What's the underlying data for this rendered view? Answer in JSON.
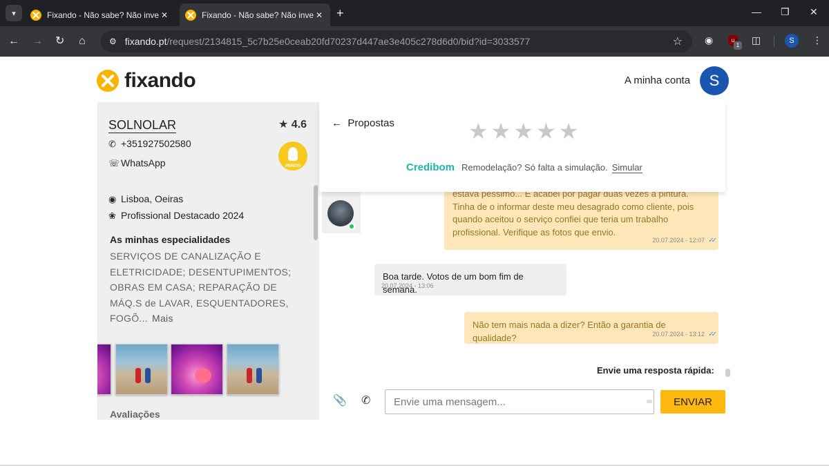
{
  "browser": {
    "tabs": [
      {
        "title": "Fixando - Não sabe? Não inventa!",
        "active": false
      },
      {
        "title": "Fixando - Não sabe? Não inventa!",
        "active": true
      }
    ],
    "url_host": "fixando.pt",
    "url_path": "/request/2134815_5c7b25e0ceab20fd70237d447ae3e405c278d6d0/bid?id=3033577",
    "profile_initial": "S",
    "extension_badge": "1"
  },
  "site": {
    "logo_text": "fixando",
    "account_label": "A minha conta",
    "avatar_initial": "S",
    "brand_color": "#f9b400"
  },
  "professional": {
    "name": "SOLNOLAR",
    "rating": "4.6",
    "phone": "+351927502580",
    "whatsapp": "WhatsApp",
    "badge_label": "PERITO",
    "location": "Lisboa, Oeiras",
    "highlight": "Profissional Destacado 2024",
    "specialties_title": "As minhas especialidades",
    "specialties_text": "SERVIÇOS DE CANALIZAÇÃO E ELETRICIDADE; DESENTUPIMENTOS; OBRAS EM CASA; REPARAÇÃO DE MÁQ.S de LAVAR, ESQUENTADORES, FOGÕ...",
    "specialties_more": "Mais",
    "reviews_title": "Avaliações"
  },
  "chat": {
    "back_label": "Propostas",
    "rating_stars": 5,
    "promo_brand": "Credibom",
    "promo_text": "Remodelação? Só falta a simulação.",
    "promo_link": "Simular",
    "messages": [
      {
        "direction": "out",
        "text": "estava péssimo... E acabei por pagar duas vezes a pintura. Tinha de o informar deste meu desagrado como cliente, pois quando aceitou o serviço confiei que teria um trabalho profissional. Verifique as fotos que envio.",
        "time": "20.07.2024 - 12:07"
      },
      {
        "direction": "in",
        "text": "Boa tarde. Votos de um bom fim de semana.",
        "time": "20.07.2024 - 13:06"
      },
      {
        "direction": "out",
        "text": "Não tem mais nada a dizer? Então a garantia de qualidade?",
        "time": "20.07.2024 - 13:12"
      }
    ],
    "quick_reply_label": "Envie uma resposta rápida:",
    "input_placeholder": "Envie uma mensagem...",
    "send_label": "ENVIAR"
  }
}
